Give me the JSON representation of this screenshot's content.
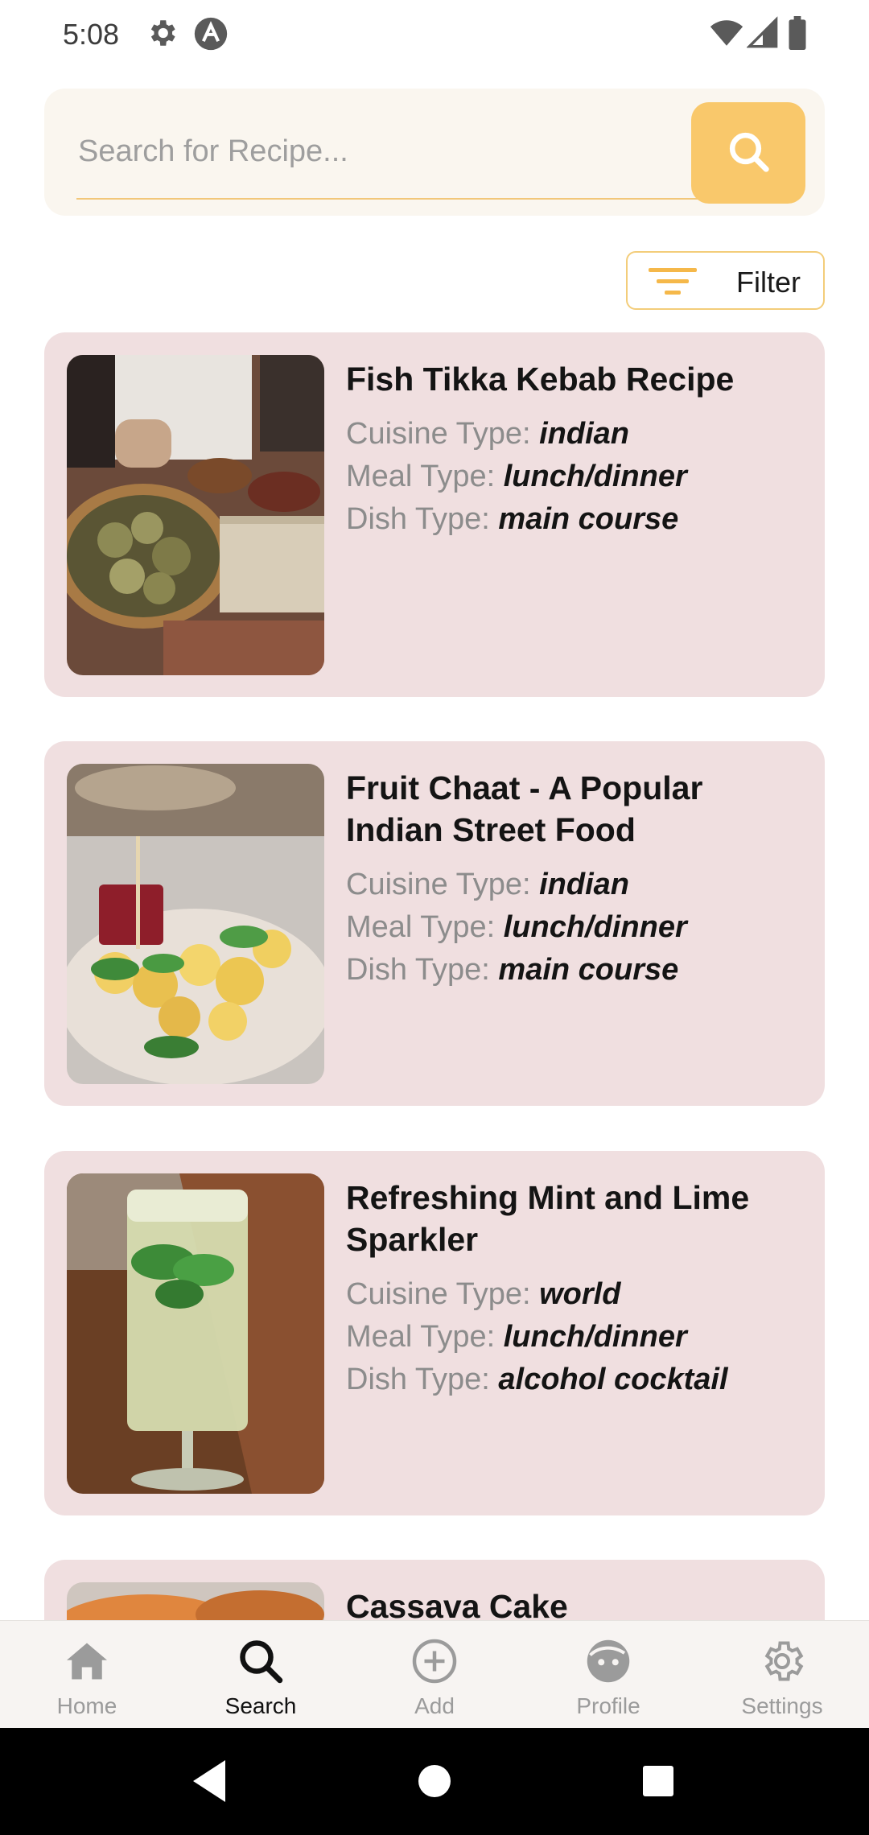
{
  "status_bar": {
    "time": "5:08",
    "icons": [
      "gear-icon",
      "app-logo-icon",
      "wifi-icon",
      "signal-icon",
      "battery-icon"
    ]
  },
  "search": {
    "placeholder": "Search for Recipe...",
    "value": "",
    "button_icon": "search-icon"
  },
  "filter": {
    "label": "Filter",
    "icon": "filter-lines-icon"
  },
  "recipes": [
    {
      "title": "Fish Tikka Kebab Recipe",
      "cuisine_label": "Cuisine Type:",
      "cuisine": "indian",
      "meal_label": "Meal Type:",
      "meal": "lunch/dinner",
      "dish_label": "Dish Type:",
      "dish": "main course"
    },
    {
      "title": "Fruit Chaat - A Popular Indian Street Food",
      "cuisine_label": "Cuisine Type:",
      "cuisine": "indian",
      "meal_label": "Meal Type:",
      "meal": "lunch/dinner",
      "dish_label": "Dish Type:",
      "dish": "main course"
    },
    {
      "title": "Refreshing Mint and Lime Sparkler",
      "cuisine_label": "Cuisine Type:",
      "cuisine": "world",
      "meal_label": "Meal Type:",
      "meal": "lunch/dinner",
      "dish_label": "Dish Type:",
      "dish": "alcohol cocktail"
    },
    {
      "title": "Cassava Cake"
    }
  ],
  "bottom_nav": {
    "items": [
      {
        "label": "Home",
        "icon": "home-icon",
        "active": false
      },
      {
        "label": "Search",
        "icon": "search-icon",
        "active": true
      },
      {
        "label": "Add",
        "icon": "add-circle-icon",
        "active": false
      },
      {
        "label": "Profile",
        "icon": "profile-face-icon",
        "active": false
      },
      {
        "label": "Settings",
        "icon": "settings-gear-icon",
        "active": false
      }
    ]
  },
  "colors": {
    "accent": "#f9c86b",
    "card_bg": "#f0dfe0",
    "search_panel_bg": "#faf6ef",
    "nav_bg": "#f7f4f2"
  }
}
